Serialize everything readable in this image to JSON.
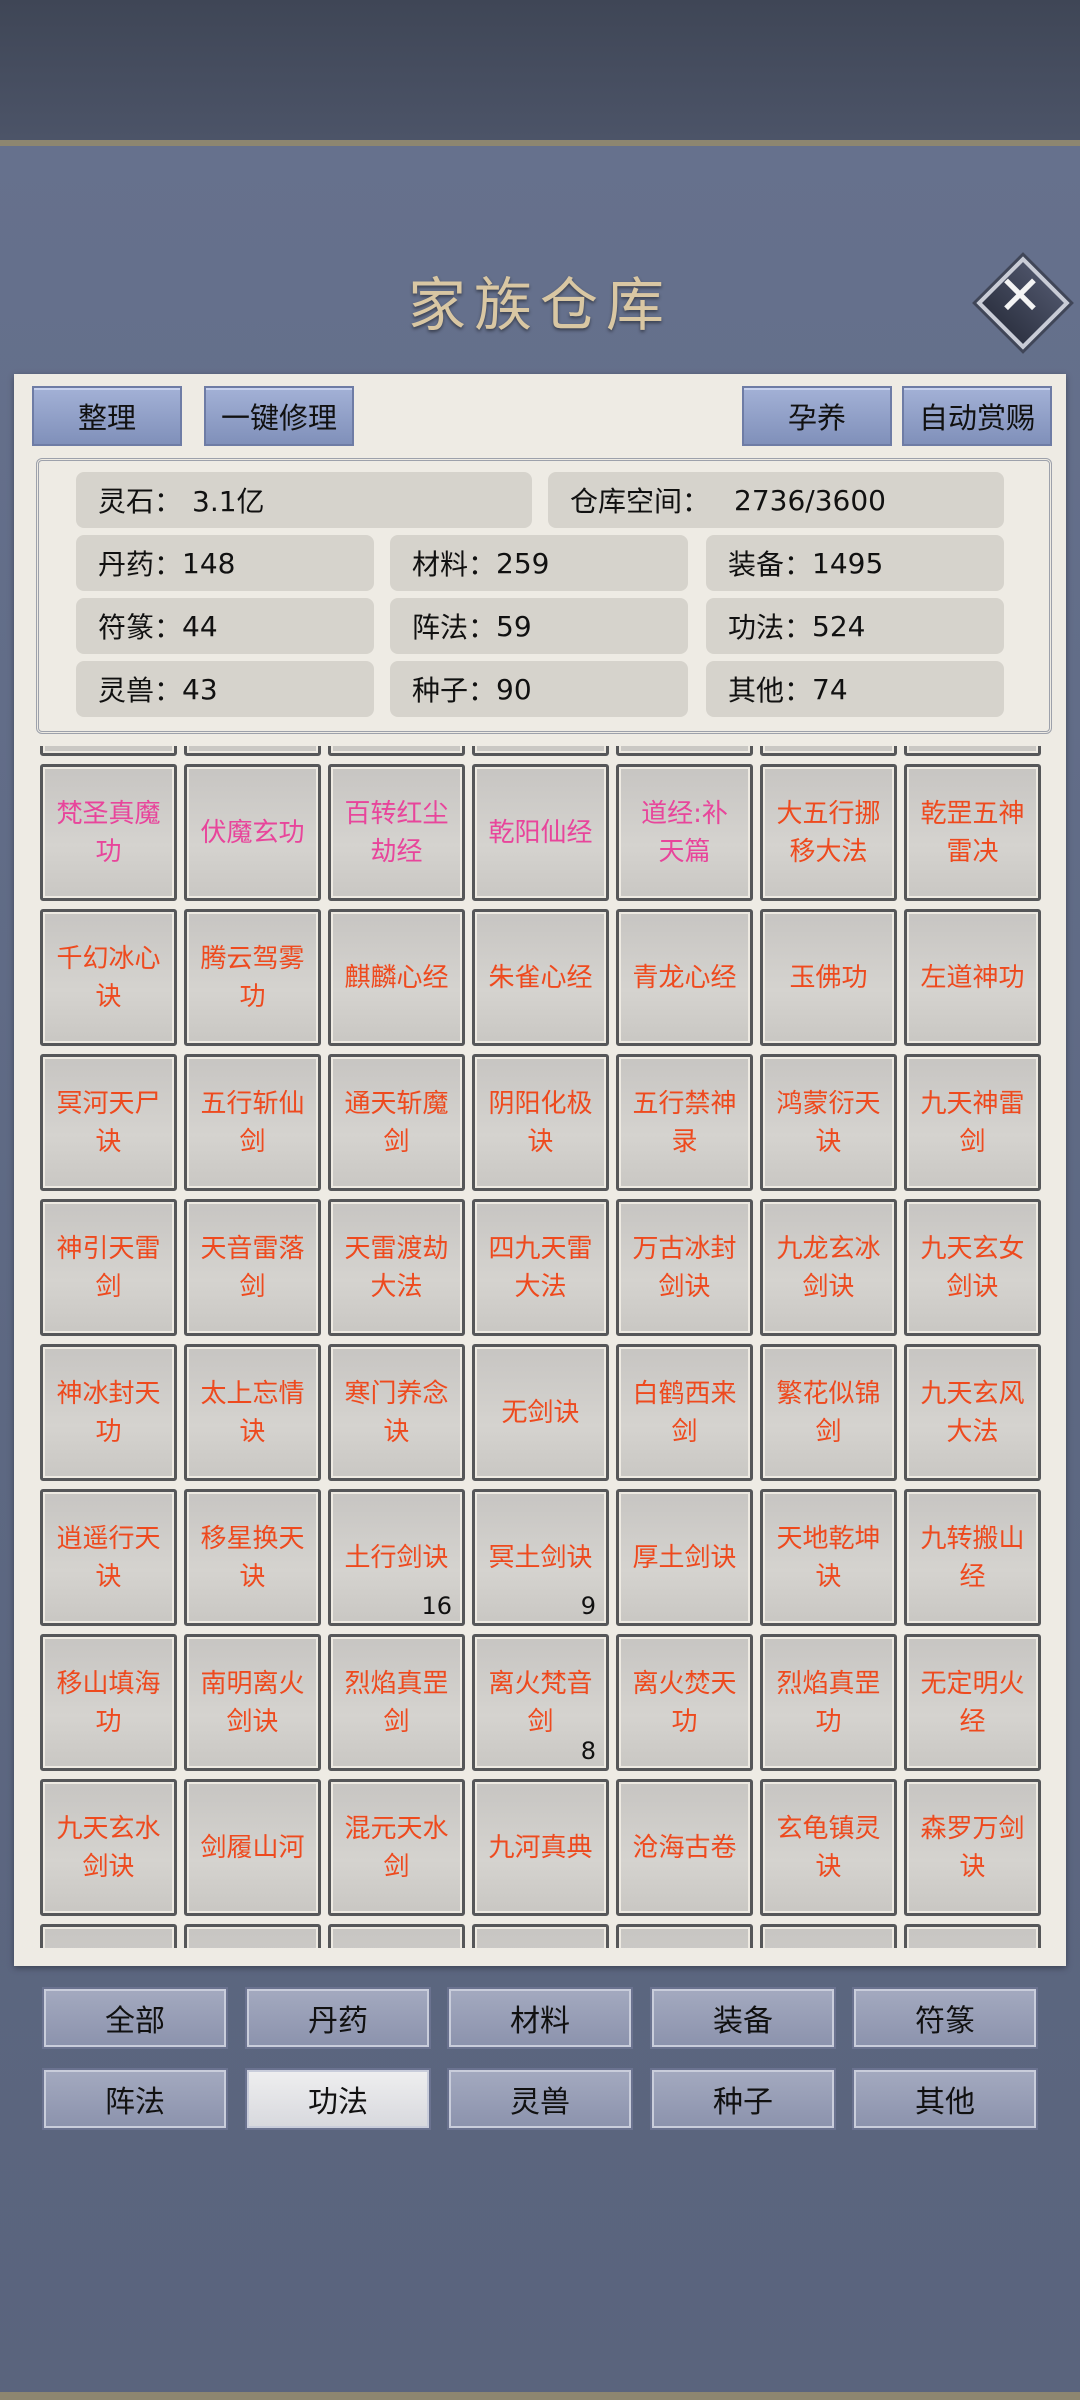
{
  "title": "家族仓库",
  "toolbar": {
    "sort": "整理",
    "repair_all": "一键修理",
    "nurture": "孕养",
    "auto_reward": "自动赏赐"
  },
  "stats": {
    "spirit_stone": {
      "label": "灵石：",
      "value": "3.1亿"
    },
    "space": {
      "label": "仓库空间：",
      "value": "2736/3600"
    },
    "items": [
      {
        "label": "丹药：",
        "value": "148"
      },
      {
        "label": "材料：",
        "value": "259"
      },
      {
        "label": "装备：",
        "value": "1495"
      },
      {
        "label": "符篆：",
        "value": "44"
      },
      {
        "label": "阵法：",
        "value": "59"
      },
      {
        "label": "功法：",
        "value": "524"
      },
      {
        "label": "灵兽：",
        "value": "43"
      },
      {
        "label": "种子：",
        "value": "90"
      },
      {
        "label": "其他：",
        "value": "74"
      }
    ]
  },
  "colors": {
    "pink": "#e8459b",
    "orange": "#ee4a1e"
  },
  "grid": [
    [
      {
        "name": "梵圣真魔功",
        "color": "pink"
      },
      {
        "name": "伏魔玄功",
        "color": "pink"
      },
      {
        "name": "百转红尘劫经",
        "color": "pink"
      },
      {
        "name": "乾阳仙经",
        "color": "pink"
      },
      {
        "name": "道经:补天篇",
        "color": "pink"
      },
      {
        "name": "大五行挪移大法",
        "color": "orange"
      },
      {
        "name": "乾罡五神雷决",
        "color": "orange"
      }
    ],
    [
      {
        "name": "千幻冰心诀",
        "color": "orange"
      },
      {
        "name": "腾云驾雾功",
        "color": "orange"
      },
      {
        "name": "麒麟心经",
        "color": "orange"
      },
      {
        "name": "朱雀心经",
        "color": "orange"
      },
      {
        "name": "青龙心经",
        "color": "orange"
      },
      {
        "name": "玉佛功",
        "color": "orange"
      },
      {
        "name": "左道神功",
        "color": "orange"
      }
    ],
    [
      {
        "name": "冥河天尸诀",
        "color": "orange"
      },
      {
        "name": "五行斩仙剑",
        "color": "orange"
      },
      {
        "name": "通天斩魔剑",
        "color": "orange"
      },
      {
        "name": "阴阳化极诀",
        "color": "orange"
      },
      {
        "name": "五行禁神录",
        "color": "orange"
      },
      {
        "name": "鸿蒙衍天诀",
        "color": "orange"
      },
      {
        "name": "九天神雷剑",
        "color": "orange"
      }
    ],
    [
      {
        "name": "神引天雷剑",
        "color": "orange"
      },
      {
        "name": "天音雷落剑",
        "color": "orange"
      },
      {
        "name": "天雷渡劫大法",
        "color": "orange"
      },
      {
        "name": "四九天雷大法",
        "color": "orange"
      },
      {
        "name": "万古冰封剑诀",
        "color": "orange"
      },
      {
        "name": "九龙玄冰剑诀",
        "color": "orange"
      },
      {
        "name": "九天玄女剑诀",
        "color": "orange"
      }
    ],
    [
      {
        "name": "神冰封天功",
        "color": "orange"
      },
      {
        "name": "太上忘情诀",
        "color": "orange"
      },
      {
        "name": "寒门养念诀",
        "color": "orange"
      },
      {
        "name": "无剑诀",
        "color": "orange"
      },
      {
        "name": "白鹤西来剑",
        "color": "orange"
      },
      {
        "name": "繁花似锦剑",
        "color": "orange"
      },
      {
        "name": "九天玄风大法",
        "color": "orange"
      }
    ],
    [
      {
        "name": "逍遥行天诀",
        "color": "orange"
      },
      {
        "name": "移星换天诀",
        "color": "orange"
      },
      {
        "name": "土行剑诀",
        "color": "orange",
        "count": "16"
      },
      {
        "name": "冥土剑诀",
        "color": "orange",
        "count": "9"
      },
      {
        "name": "厚土剑诀",
        "color": "orange"
      },
      {
        "name": "天地乾坤诀",
        "color": "orange"
      },
      {
        "name": "九转搬山经",
        "color": "orange"
      }
    ],
    [
      {
        "name": "移山填海功",
        "color": "orange"
      },
      {
        "name": "南明离火剑诀",
        "color": "orange"
      },
      {
        "name": "烈焰真罡剑",
        "color": "orange"
      },
      {
        "name": "离火梵音剑",
        "color": "orange",
        "count": "8"
      },
      {
        "name": "离火焚天功",
        "color": "orange"
      },
      {
        "name": "烈焰真罡功",
        "color": "orange"
      },
      {
        "name": "无定明火经",
        "color": "orange"
      }
    ],
    [
      {
        "name": "九天玄水剑诀",
        "color": "orange"
      },
      {
        "name": "剑履山河",
        "color": "orange"
      },
      {
        "name": "混元天水剑",
        "color": "orange"
      },
      {
        "name": "九河真典",
        "color": "orange"
      },
      {
        "name": "沧海古卷",
        "color": "orange"
      },
      {
        "name": "玄龟镇灵诀",
        "color": "orange"
      },
      {
        "name": "森罗万剑诀",
        "color": "orange"
      }
    ]
  ],
  "categories": [
    {
      "label": "全部",
      "active": false
    },
    {
      "label": "丹药",
      "active": false
    },
    {
      "label": "材料",
      "active": false
    },
    {
      "label": "装备",
      "active": false
    },
    {
      "label": "符篆",
      "active": false
    },
    {
      "label": "阵法",
      "active": false
    },
    {
      "label": "功法",
      "active": true
    },
    {
      "label": "灵兽",
      "active": false
    },
    {
      "label": "种子",
      "active": false
    },
    {
      "label": "其他",
      "active": false
    }
  ]
}
